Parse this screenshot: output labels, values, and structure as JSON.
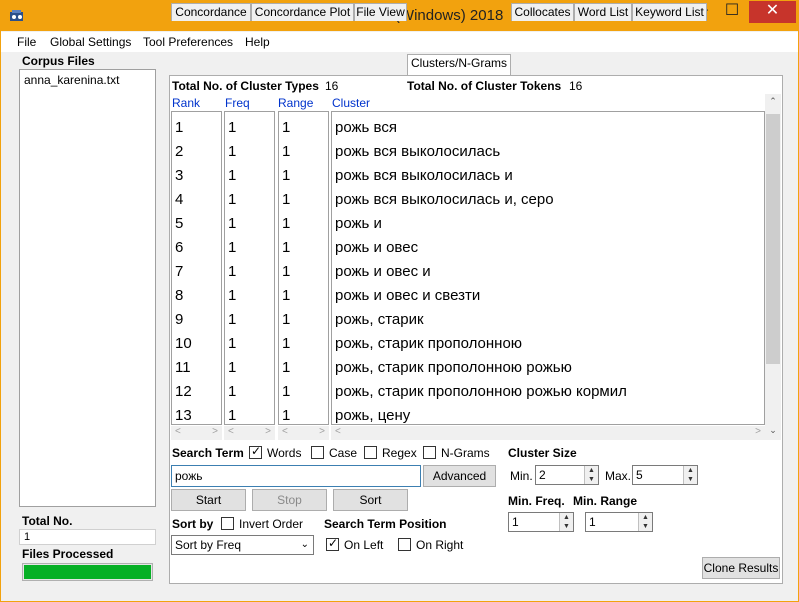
{
  "window": {
    "title": "AntConc 3.5.6 (Windows) 2018",
    "min": "─",
    "max": "☐",
    "close": "✕",
    "accent": "#f2a20e"
  },
  "menu": [
    "File",
    "Global Settings",
    "Tool Preferences",
    "Help"
  ],
  "corpus": {
    "heading": "Corpus Files",
    "files": [
      "anna_karenina.txt"
    ],
    "total_label": "Total No.",
    "total_value": "1",
    "processed_label": "Files Processed",
    "progress": 1.0
  },
  "tabs": [
    "Concordance",
    "Concordance Plot",
    "File View",
    "Clusters/N-Grams",
    "Collocates",
    "Word List",
    "Keyword List"
  ],
  "active_tab": "Clusters/N-Grams",
  "stats": {
    "types_label": "Total No. of Cluster Types",
    "types_value": "16",
    "tokens_label": "Total No. of Cluster Tokens",
    "tokens_value": "16"
  },
  "columns": [
    "Rank",
    "Freq",
    "Range",
    "Cluster"
  ],
  "rows": [
    {
      "rank": "1",
      "freq": "1",
      "range": "1",
      "cluster": "рожь вся"
    },
    {
      "rank": "2",
      "freq": "1",
      "range": "1",
      "cluster": "рожь вся выколосилась"
    },
    {
      "rank": "3",
      "freq": "1",
      "range": "1",
      "cluster": "рожь вся выколосилась и"
    },
    {
      "rank": "4",
      "freq": "1",
      "range": "1",
      "cluster": "рожь вся выколосилась и, серо"
    },
    {
      "rank": "5",
      "freq": "1",
      "range": "1",
      "cluster": "рожь и"
    },
    {
      "rank": "6",
      "freq": "1",
      "range": "1",
      "cluster": "рожь и овес"
    },
    {
      "rank": "7",
      "freq": "1",
      "range": "1",
      "cluster": "рожь и овес и"
    },
    {
      "rank": "8",
      "freq": "1",
      "range": "1",
      "cluster": "рожь и овес и свезти"
    },
    {
      "rank": "9",
      "freq": "1",
      "range": "1",
      "cluster": "рожь, старик"
    },
    {
      "rank": "10",
      "freq": "1",
      "range": "1",
      "cluster": "рожь, старик прополонною"
    },
    {
      "rank": "11",
      "freq": "1",
      "range": "1",
      "cluster": "рожь, старик прополонною рожью"
    },
    {
      "rank": "12",
      "freq": "1",
      "range": "1",
      "cluster": "рожь, старик прополонною рожью кормил"
    },
    {
      "rank": "13",
      "freq": "1",
      "range": "1",
      "cluster": "рожь, цену"
    }
  ],
  "search": {
    "label": "Search Term",
    "options": [
      {
        "label": "Words",
        "checked": true
      },
      {
        "label": "Case",
        "checked": false
      },
      {
        "label": "Regex",
        "checked": false
      },
      {
        "label": "N-Grams",
        "checked": false
      }
    ],
    "value": "рожь",
    "advanced": "Advanced"
  },
  "buttons": {
    "start": "Start",
    "stop": "Stop",
    "sort": "Sort",
    "clone": "Clone Results"
  },
  "sort": {
    "label": "Sort by",
    "invert_label": "Invert Order",
    "invert_checked": false,
    "selected": "Sort by Freq"
  },
  "position": {
    "label": "Search Term Position",
    "on_left": "On Left",
    "on_left_checked": true,
    "on_right": "On Right",
    "on_right_checked": false
  },
  "cluster_size": {
    "label": "Cluster Size",
    "min_label": "Min.",
    "min_value": "2",
    "max_label": "Max.",
    "max_value": "5"
  },
  "min_freq": {
    "label": "Min. Freq.",
    "value": "1"
  },
  "min_range": {
    "label": "Min. Range",
    "value": "1"
  }
}
